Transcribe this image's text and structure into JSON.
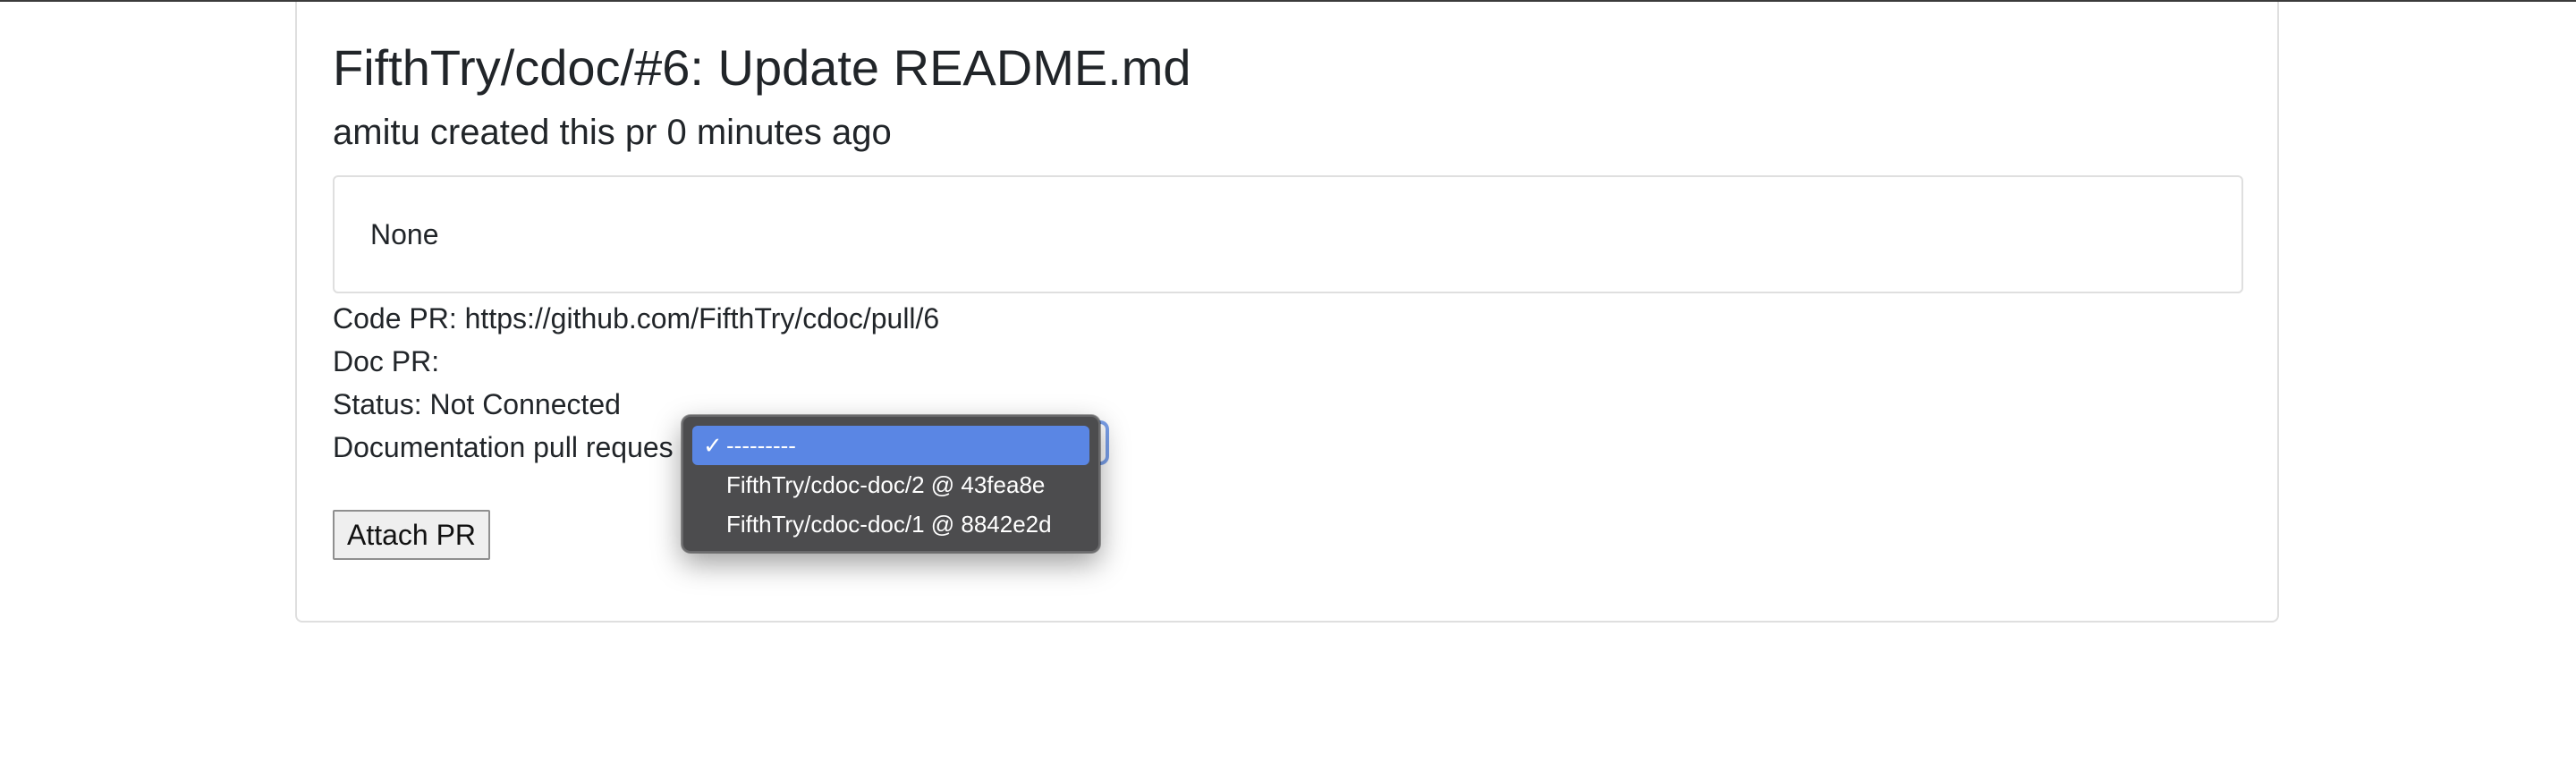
{
  "pr": {
    "title": "FifthTry/cdoc/#6: Update README.md",
    "subtitle": "amitu created this pr 0 minutes ago",
    "description": "None",
    "code_pr_line": "Code PR: https://github.com/FifthTry/cdoc/pull/6",
    "doc_pr_line": "Doc PR:",
    "status_line": "Status: Not Connected",
    "doc_select_label": "Documentation pull reques"
  },
  "dropdown": {
    "selected_index": 0,
    "check_icon": "checkmark-icon",
    "options": [
      {
        "label": "---------",
        "check": "✓"
      },
      {
        "label": "FifthTry/cdoc-doc/2 @ 43fea8e"
      },
      {
        "label": "FifthTry/cdoc-doc/1 @ 8842e2d"
      }
    ]
  },
  "actions": {
    "attach_label": "Attach PR"
  },
  "colors": {
    "highlight": "#5a86e4",
    "menu_background": "#4c4c4e",
    "focus_ring": "#7aa0ea"
  }
}
